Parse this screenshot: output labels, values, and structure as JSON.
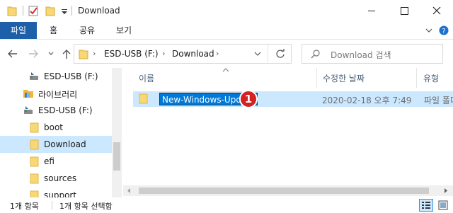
{
  "window": {
    "title": "Download",
    "minimize_icon": "minimize-icon",
    "maximize_icon": "maximize-icon",
    "close_icon": "close-icon"
  },
  "ribbon": {
    "file_tab": "파일",
    "tabs": [
      "홈",
      "공유",
      "보기"
    ]
  },
  "address": {
    "path": [
      "ESD-USB (F:)",
      "Download"
    ],
    "search_placeholder": "Download 검색"
  },
  "nav_pane": {
    "items": [
      {
        "label": "ESD-USB (F:)",
        "icon": "usb-drive-icon"
      },
      {
        "label": "라이브러리",
        "icon": "library-icon"
      },
      {
        "label": "ESD-USB (F:)",
        "icon": "usb-drive-icon"
      },
      {
        "label": "boot",
        "icon": "folder-icon"
      },
      {
        "label": "Download",
        "icon": "folder-icon",
        "selected": true
      },
      {
        "label": "efi",
        "icon": "folder-icon"
      },
      {
        "label": "sources",
        "icon": "folder-icon"
      },
      {
        "label": "support",
        "icon": "folder-icon"
      }
    ]
  },
  "file_list": {
    "columns": [
      "이름",
      "수정한 날짜",
      "유형"
    ],
    "rows": [
      {
        "name": "New-Windows-Update",
        "modified": "2020-02-18 오후 7:49",
        "type": "파일 폴더",
        "renaming": true
      }
    ],
    "step_badge": "1"
  },
  "status": {
    "item_count": "1개 항목",
    "selected_count": "1개 항목 선택함"
  },
  "colors": {
    "accent": "#0078d7",
    "file_tab": "#1d5fa8",
    "selection": "#cce8ff",
    "badge": "#d42121",
    "folder": "#f8d775"
  }
}
